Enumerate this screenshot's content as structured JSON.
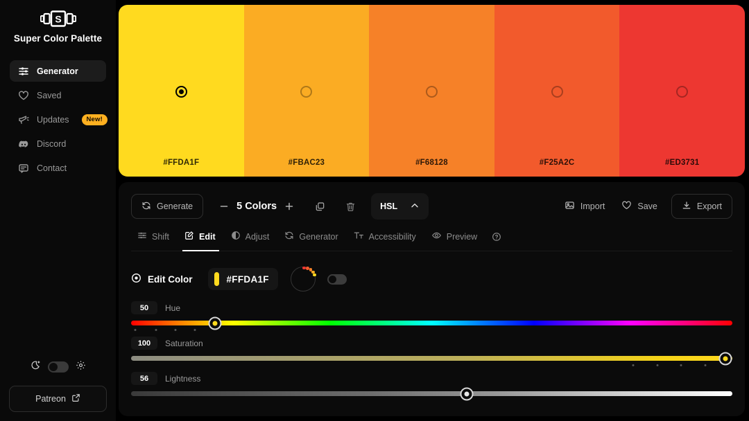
{
  "sidebar": {
    "brand": "Super Color Palette",
    "logo_icon": "film-strip-s-logo",
    "items": [
      {
        "label": "Generator",
        "icon": "sliders-icon",
        "active": true
      },
      {
        "label": "Saved",
        "icon": "heart-icon",
        "active": false
      },
      {
        "label": "Updates",
        "icon": "megaphone-icon",
        "active": false,
        "badge": "New!"
      },
      {
        "label": "Discord",
        "icon": "discord-icon",
        "active": false
      },
      {
        "label": "Contact",
        "icon": "message-icon",
        "active": false
      }
    ],
    "theme": {
      "moon_icon": "moon-icon",
      "gear_icon": "gear-icon",
      "toggle_on": false
    },
    "patreon": {
      "label": "Patreon",
      "icon": "external-link-icon"
    }
  },
  "palette": {
    "selected_index": 0,
    "swatches": [
      {
        "hex": "#FFDA1F"
      },
      {
        "hex": "#FBAC23"
      },
      {
        "hex": "#F68128"
      },
      {
        "hex": "#F25A2C"
      },
      {
        "hex": "#ED3731"
      }
    ]
  },
  "toolbar": {
    "generate_label": "Generate",
    "generate_icon": "refresh-icon",
    "minus_icon": "minus-icon",
    "plus_icon": "plus-icon",
    "count_label": "5 Colors",
    "copy_icon": "copy-icon",
    "delete_icon": "trash-icon",
    "color_mode": "HSL",
    "color_mode_icon": "chevron-up-icon",
    "import_label": "Import",
    "import_icon": "image-icon",
    "save_label": "Save",
    "save_icon": "heart-icon",
    "export_label": "Export",
    "export_icon": "download-icon"
  },
  "tabs": [
    {
      "label": "Shift",
      "icon": "sliders-icon",
      "active": false
    },
    {
      "label": "Edit",
      "icon": "pencil-square-icon",
      "active": true
    },
    {
      "label": "Adjust",
      "icon": "contrast-icon",
      "active": false
    },
    {
      "label": "Generator",
      "icon": "refresh-icon",
      "active": false
    },
    {
      "label": "Accessibility",
      "icon": "text-size-icon",
      "active": false
    },
    {
      "label": "Preview",
      "icon": "eye-icon",
      "active": false
    }
  ],
  "tab_help_icon": "question-circle-icon",
  "edit_panel": {
    "title": "Edit Color",
    "title_icon": "target-dot-icon",
    "hex_value": "#FFDA1F",
    "chip_color": "#FFDA1F",
    "wheel_icon": "color-wheel-icon",
    "lock_toggle_on": false,
    "sliders": [
      {
        "name": "Hue",
        "value": "50",
        "percent": 13.9,
        "handle_color": "#FFDA1F",
        "ticks": [
          0.7,
          4.1,
          7.4,
          10.6
        ]
      },
      {
        "name": "Saturation",
        "value": "100",
        "percent": 98.8,
        "handle_color": "#FFDA1F",
        "ticks": [
          83.5,
          87.5,
          91.5,
          95.5
        ]
      },
      {
        "name": "Lightness",
        "value": "56",
        "percent": 55.8,
        "handle_color": "#e8e8e8",
        "ticks": []
      }
    ]
  }
}
